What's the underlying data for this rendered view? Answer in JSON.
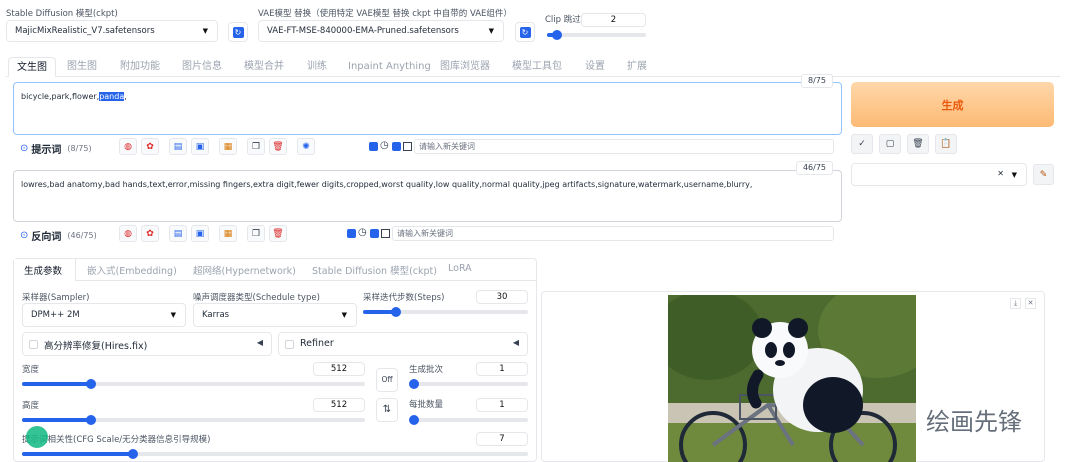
{
  "top": {
    "model_label": "Stable Diffusion 模型(ckpt)",
    "model_value": "MajicMixRealistic_V7.safetensors",
    "vae_label": "VAE模型 替换（使用特定 VAE模型 替换 ckpt 中自带的 VAE组件）",
    "vae_value": "VAE-FT-MSE-840000-EMA-Pruned.safetensors",
    "clip_label": "Clip 跳过层",
    "clip_value": "2",
    "clip_fraction": 0.1
  },
  "tabs": [
    "文生图",
    "图生图",
    "附加功能",
    "图片信息",
    "模型合并",
    "训练",
    "Inpaint Anything",
    "图库浏览器",
    "模型工具包",
    "设置",
    "扩展"
  ],
  "prompt": {
    "text_before": "bicycle,park,flower,",
    "text_selected": "panda",
    "text_after": ",",
    "counter": "8/75",
    "label": "提示词",
    "count": "(8/75)",
    "keyword_placeholder": "请输入新关键词"
  },
  "negative": {
    "text": "lowres,bad anatomy,bad hands,text,error,missing fingers,extra digit,fewer digits,cropped,worst quality,low quality,normal quality,jpeg artifacts,signature,watermark,username,blurry,",
    "counter": "46/75",
    "label": "反向词",
    "count": "(46/75)",
    "keyword_placeholder": "请输入新关键词"
  },
  "generate": {
    "label": "生成",
    "color": "#f97316"
  },
  "subtabs": [
    "生成参数",
    "嵌入式(Embedding)",
    "超网络(Hypernetwork)",
    "Stable Diffusion 模型(ckpt)",
    "LoRA"
  ],
  "params": {
    "sampler_label": "采样器(Sampler)",
    "sampler_value": "DPM++ 2M",
    "schedule_label": "噪声调度器类型(Schedule type)",
    "schedule_value": "Karras",
    "steps_label": "采样迭代步数(Steps)",
    "steps_value": "30",
    "steps_fraction": 0.2,
    "hires_label": "高分辨率修复(Hires.fix)",
    "refiner_label": "Refiner",
    "width_label": "宽度",
    "width_value": "512",
    "width_fraction": 0.2,
    "height_label": "高度",
    "height_value": "512",
    "height_fraction": 0.2,
    "off_label": "Off",
    "batch_count_label": "生成批次",
    "batch_count_value": "1",
    "batch_size_label": "每批数量",
    "batch_size_value": "1",
    "cfg_label": "提示词相关性(CFG Scale/无分类器信息引导规模)",
    "cfg_value": "7",
    "cfg_fraction": 0.22
  },
  "watermark_text": "绘画先锋"
}
